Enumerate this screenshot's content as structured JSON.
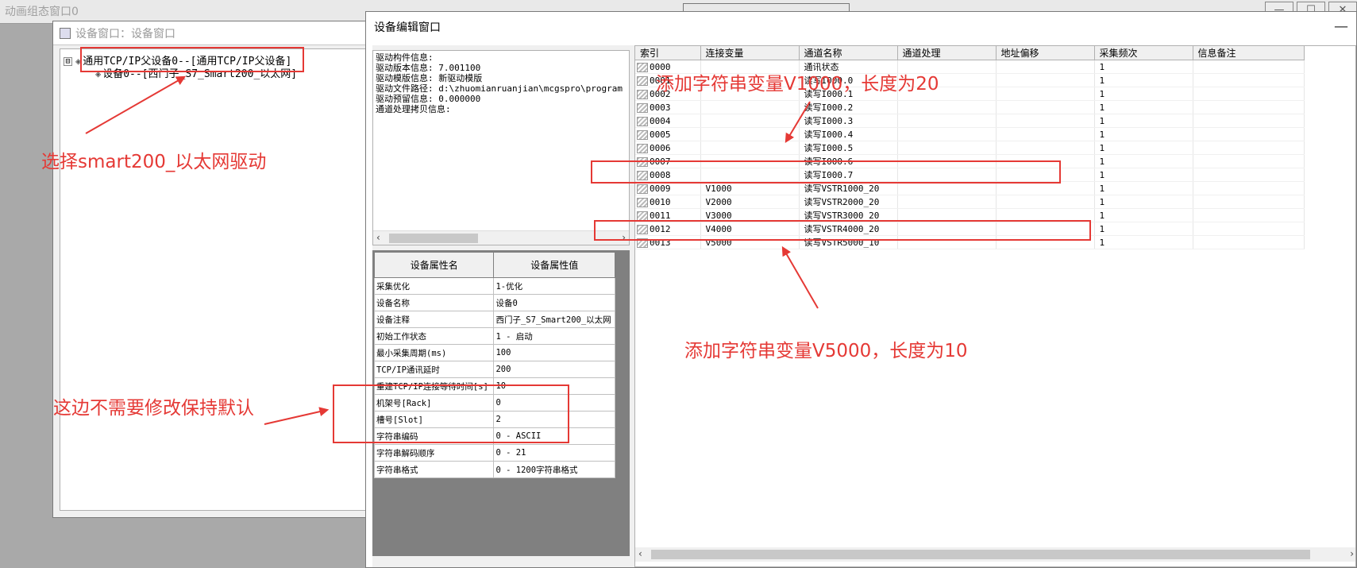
{
  "background_window": {
    "title": "动画组态窗口0",
    "controls": [
      "—",
      "☐",
      "✕"
    ]
  },
  "device_window": {
    "title": "设备窗口：设备窗口",
    "tree": {
      "toggle": "⊟",
      "root": "通用TCP/IP父设备0--[通用TCP/IP父设备]",
      "child": "设备0--[西门子_S7_Smart200_以太网]"
    }
  },
  "edit_window": {
    "title": "设备编辑窗口",
    "minimize": "—",
    "driver_info": [
      "驱动构件信息:",
      "驱动版本信息: 7.001100",
      "驱动模版信息: 新驱动模版",
      "驱动文件路径: d:\\zhuomianruanjian\\mcgspro\\program",
      "驱动预留信息: 0.000000",
      "通道处理拷贝信息:"
    ],
    "properties": {
      "header_name": "设备属性名",
      "header_value": "设备属性值",
      "rows": [
        {
          "name": "采集优化",
          "value": "1-优化"
        },
        {
          "name": "设备名称",
          "value": "设备0"
        },
        {
          "name": "设备注释",
          "value": "西门子_S7_Smart200_以太网"
        },
        {
          "name": "初始工作状态",
          "value": "1 - 启动"
        },
        {
          "name": "最小采集周期(ms)",
          "value": "100"
        },
        {
          "name": "TCP/IP通讯延时",
          "value": "200"
        },
        {
          "name": "重建TCP/IP连接等待时间[s]",
          "value": "10"
        },
        {
          "name": "机架号[Rack]",
          "value": "0"
        },
        {
          "name": "槽号[Slot]",
          "value": "2"
        },
        {
          "name": "字符串编码",
          "value": "0 - ASCII"
        },
        {
          "name": "字符串解码顺序",
          "value": "0 - 21"
        },
        {
          "name": "字符串格式",
          "value": "0 - 1200字符串格式"
        }
      ]
    },
    "channels": {
      "headers": [
        "索引",
        "连接变量",
        "通道名称",
        "通道处理",
        "地址偏移",
        "采集频次",
        "信息备注"
      ],
      "rows": [
        {
          "idx": "0000",
          "var": "",
          "name": "通讯状态",
          "freq": "1"
        },
        {
          "idx": "0001",
          "var": "",
          "name": "读写I000.0",
          "freq": "1"
        },
        {
          "idx": "0002",
          "var": "",
          "name": "读写I000.1",
          "freq": "1"
        },
        {
          "idx": "0003",
          "var": "",
          "name": "读写I000.2",
          "freq": "1"
        },
        {
          "idx": "0004",
          "var": "",
          "name": "读写I000.3",
          "freq": "1"
        },
        {
          "idx": "0005",
          "var": "",
          "name": "读写I000.4",
          "freq": "1"
        },
        {
          "idx": "0006",
          "var": "",
          "name": "读写I000.5",
          "freq": "1"
        },
        {
          "idx": "0007",
          "var": "",
          "name": "读写I000.6",
          "freq": "1"
        },
        {
          "idx": "0008",
          "var": "",
          "name": "读写I000.7",
          "freq": "1"
        },
        {
          "idx": "0009",
          "var": "V1000",
          "name": "读写VSTR1000_20",
          "freq": "1"
        },
        {
          "idx": "0010",
          "var": "V2000",
          "name": "读写VSTR2000_20",
          "freq": "1"
        },
        {
          "idx": "0011",
          "var": "V3000",
          "name": "读写VSTR3000_20",
          "freq": "1"
        },
        {
          "idx": "0012",
          "var": "V4000",
          "name": "读写VSTR4000_20",
          "freq": "1"
        },
        {
          "idx": "0013",
          "var": "v5000",
          "name": "读写VSTR5000_10",
          "freq": "1"
        }
      ]
    }
  },
  "annotations": {
    "select_driver": "选择smart200_以太网驱动",
    "add_v1000": "添加字符串变量V1000，长度为20",
    "add_v5000": "添加字符串变量V5000，长度为10",
    "keep_default": "这边不需要修改保持默认"
  },
  "colors": {
    "annotation": "#e53935",
    "desktop": "#a9a9a9",
    "panel": "#f0f0f0"
  }
}
